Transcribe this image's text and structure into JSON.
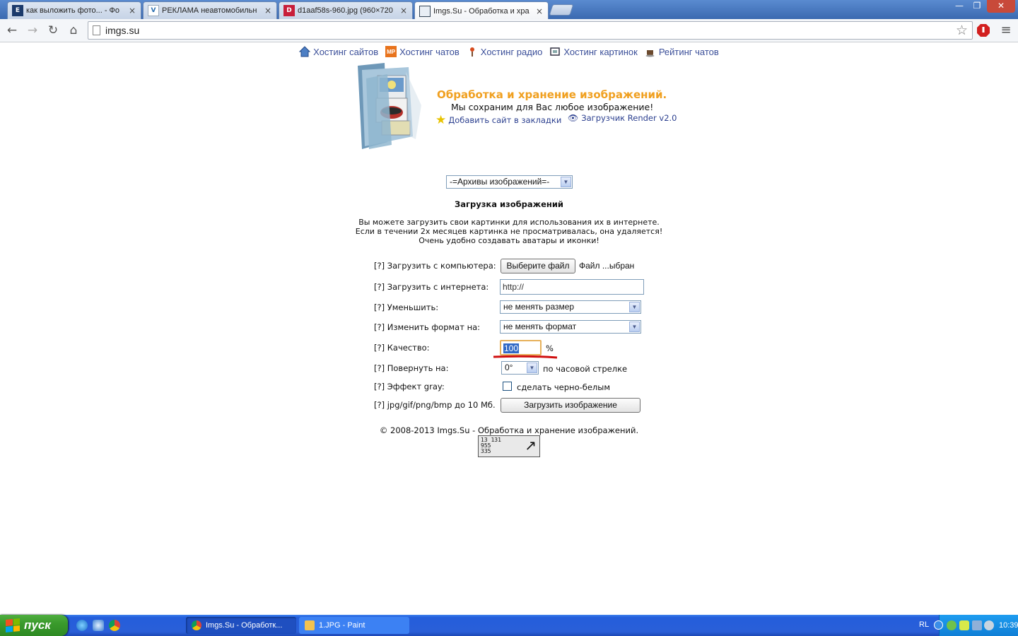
{
  "browser": {
    "tabs": [
      {
        "title": "как выложить фото... - Фо",
        "favicon": "exler-icon",
        "active": false
      },
      {
        "title": "РЕКЛАМА неавтомобильн",
        "favicon": "v-logo-icon",
        "active": false
      },
      {
        "title": "d1aaf58s-960.jpg (960×720",
        "favicon": "d-logo-icon",
        "active": false
      },
      {
        "title": "Imgs.Su - Обработка и хра",
        "favicon": "imgs-icon",
        "active": true
      }
    ],
    "tab_close_glyph": "×",
    "address": "imgs.su",
    "window_controls": {
      "minimize": "—",
      "restore": "❐",
      "close": "✕"
    }
  },
  "page": {
    "topnav": [
      {
        "label": "Хостинг сайтов",
        "icon": "house-icon"
      },
      {
        "label": "Хостинг чатов",
        "icon": "mp-icon"
      },
      {
        "label": "Хостинг радио",
        "icon": "radio-icon"
      },
      {
        "label": "Хостинг картинок",
        "icon": "frame-icon"
      },
      {
        "label": "Рейтинг чатов",
        "icon": "coffee-icon"
      }
    ],
    "header": {
      "title": "Обработка и хранение изображений.",
      "subtitle": "Мы сохраним для Вас любое изображение!",
      "bookmark_link": "Добавить сайт в закладки",
      "loader_link": "Загрузчик Render v2.0"
    },
    "archive_select": "-=Архивы изображений=-",
    "section_title": "Загрузка изображений",
    "description": [
      "Вы можете загрузить свои картинки для использования их в интернете.",
      "Если в течении 2х месяцев картинка не просматривалась, она удаляется!",
      "Очень удобно создавать аватары и иконки!"
    ],
    "form": {
      "upload_computer_label": "[?] Загрузить с компьютера:",
      "choose_file_button": "Выберите файл",
      "file_status": "Файл ...ыбран",
      "upload_internet_label": "[?] Загрузить с интернета:",
      "url_value": "http://",
      "resize_label": "[?] Уменьшить:",
      "resize_value": "не менять размер",
      "format_label": "[?] Изменить формат на:",
      "format_value": "не менять формат",
      "quality_label": "[?] Качество:",
      "quality_value": "100",
      "quality_unit": "%",
      "rotate_label": "[?] Повернуть на:",
      "rotate_value": "0°",
      "rotate_suffix": "по часовой стрелке",
      "gray_label": "[?] Эффект gray:",
      "gray_checkbox_label": "сделать черно-белым",
      "gray_checked": false,
      "formats_label": "[?] jpg/gif/png/bmp до 10 Мб.",
      "submit_button": "Загрузить изображение"
    },
    "footer": "© 2008-2013 Imgs.Su - Обработка и хранение изображений.",
    "counter": [
      "13 131",
      "955",
      "335"
    ]
  },
  "taskbar": {
    "start_label": "пуск",
    "tasks": [
      {
        "label": "Imgs.Su - Обработк...",
        "active": true
      },
      {
        "label": "1.JPG - Paint",
        "active": false
      }
    ],
    "language": "RL",
    "clock": "10:39"
  },
  "colors": {
    "brand_orange": "#f0a020",
    "link_blue": "#3b4f99",
    "annotation_red": "#d01010",
    "selection_blue": "#3169c6"
  }
}
